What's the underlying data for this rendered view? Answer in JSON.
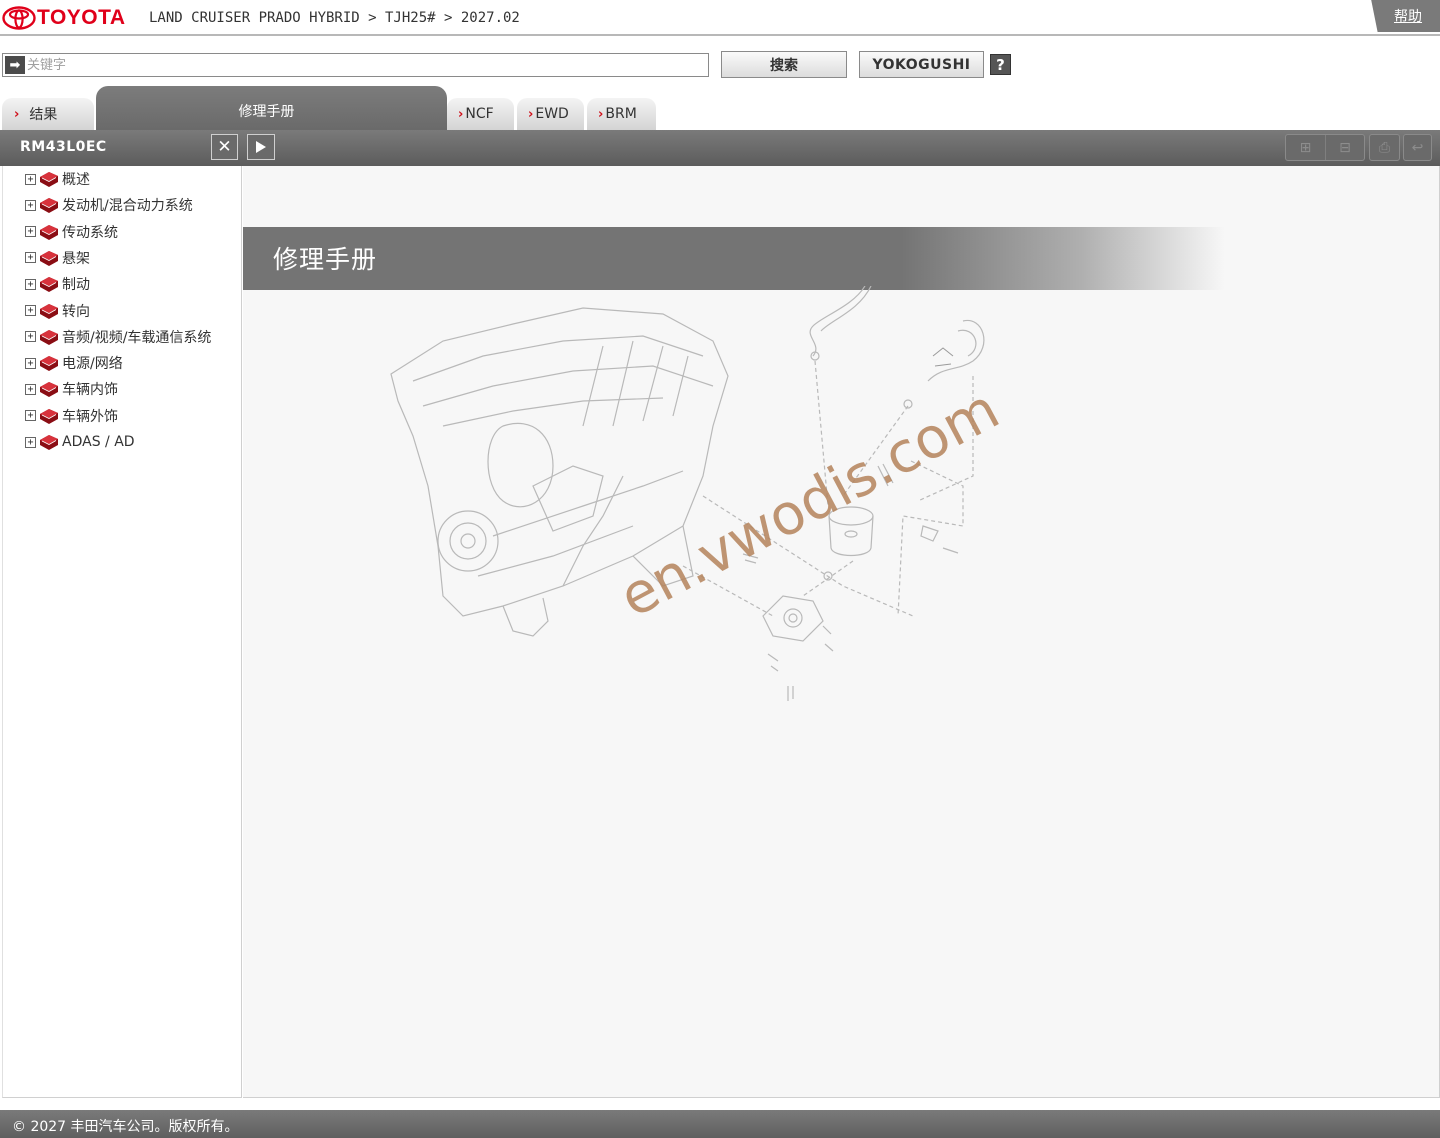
{
  "header": {
    "brand": "TOYOTA",
    "breadcrumb": "LAND CRUISER PRADO HYBRID > TJH25# > 2027.02",
    "help_label": "帮助"
  },
  "search": {
    "placeholder": "关键字",
    "search_label": "搜索",
    "yokogushi_label": "YOKOGUSHI",
    "help_q": "?"
  },
  "tabs": [
    {
      "label": "结果"
    },
    {
      "label": "修理手册"
    },
    {
      "label": "NCF"
    },
    {
      "label": "EWD"
    },
    {
      "label": "BRM"
    }
  ],
  "left_panel": {
    "title": "RM43L0EC",
    "close_label": "✕",
    "tree": [
      {
        "label": "概述"
      },
      {
        "label": "发动机/混合动力系统"
      },
      {
        "label": "传动系统"
      },
      {
        "label": "悬架"
      },
      {
        "label": "制动"
      },
      {
        "label": "转向"
      },
      {
        "label": "音频/视频/车载通信系统"
      },
      {
        "label": "电源/网络"
      },
      {
        "label": "车辆内饰"
      },
      {
        "label": "车辆外饰"
      },
      {
        "label": "ADAS / AD"
      }
    ]
  },
  "content": {
    "title": "修理手册",
    "watermark": "en.vwodis.com"
  },
  "footer": {
    "copyright": "© 2027 丰田汽车公司。版权所有。"
  },
  "colors": {
    "brand_red": "#e0001a",
    "bar_gray": "#6a6a6a",
    "watermark": "#b4825a"
  }
}
